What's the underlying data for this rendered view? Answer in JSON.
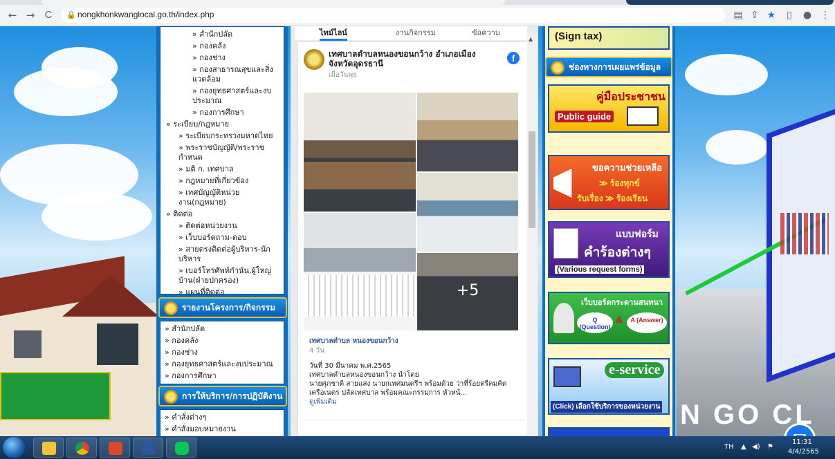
{
  "browser": {
    "url": "nongkhonkwanglocal.go.th/index.php",
    "back": "←",
    "forward": "→",
    "reload": "C",
    "lock": "🔒",
    "icons": {
      "translate": "▤",
      "share": "⇪",
      "bookmark": "★",
      "sidepanel": "▯",
      "profile": "●",
      "menu": "⋮"
    }
  },
  "left_menu": {
    "top_items": [
      "» สำนักปลัด",
      "» กองคลัง",
      "» กองช่าง",
      "» กองสาธารณสุขและสิ่งแวดล้อม",
      "» กองยุทธศาสตร์และงบประมาณ",
      "» กองการศึกษา"
    ],
    "reg_title": "» ระเบียบ/กฎหมาย",
    "reg_items": [
      "» ระเบียบกระทรวงมหาดไทย",
      "» พระราชบัญญัติ/พระราชกำหนด",
      "» มติ ก. เทศบาล",
      "» กฎหมายที่เกี่ยวข้อง",
      "» เทศบัญญัติหน่วยงาน(กฎหมาย)"
    ],
    "contact_title": "» ติดต่อ",
    "contact_items": [
      "» ติดต่อหน่วยงาน",
      "» เว็บบอร์ดถาม-ตอบ",
      "» สายตรงติดต่อผู้บริหาร-นักบริหาร",
      "» เบอร์โทรศัพท์กำนัน,ผู้ใหญ่บ้าน(ฝ่ายปกครอง)",
      "» แผนที่ติดต่อ"
    ],
    "report_head": "รายงานโครงการ/กิจกรรม",
    "report_items": [
      "» สำนักปลัด",
      "» กองคลัง",
      "» กองช่าง",
      "» กองยุทธศาสตร์และงบประมาณ",
      "» กองการศึกษา"
    ],
    "service_head": "การให้บริการ/การปฏิบัติงาน",
    "service_items": [
      "» คำสั่งต่างๆ",
      "» คำสั่งมอบหมายงาน"
    ]
  },
  "facebook": {
    "tabs": [
      "ไทม์ไลน์",
      "งานกิจกรรม",
      "ข้อความ"
    ],
    "page_name": "เทศบาลตำบลหนองขอนกว้าง อำเภอเมือง จังหวัดอุดรธานี",
    "post_time": "เมื่อวันพุธ",
    "more_photos": "+5",
    "author": "เทศบาลตำบล หนองขอนกว้าง",
    "author_time": "4 วัน",
    "date_line": "วันที่ 30 มีนาคม พ.ศ.2565",
    "body_lines": [
      "เทศบาลตำบลหนองขอนกว้าง นำโดย",
      "นายศุภชาติ สายแสง นายกเทศมนตรีฯ พร้อมด้วย ว่าที่ร้อยตรีคมคิด",
      "เครือเนตร ปลัดเทศบาล พร้อมคณะกรรมการ หัวหน้..."
    ],
    "see_more": "ดูเพิ่มเติม"
  },
  "right_col": {
    "sign_tax": "(Sign tax)",
    "channel_head": "ช่องทางการเผยแพร่ข้อมูล",
    "b1_title": "คู่มือประชาชน",
    "b1_sub": "Public guide",
    "b2_title": "ขอความช่วยเหลือ",
    "b2_l1": "≫ ร้องทุกข์",
    "b2_l2": "รับเรื่อง ≫ ร้องเรียน",
    "b3_title": "แบบฟอร์ม",
    "b3_mid": "คำร้องต่างๆ",
    "b3_sub": "(Various request forms)",
    "b4_title": "เว็บบอร์ดกระดานสนทนา",
    "b4_q": "Q (Question)",
    "b4_amp": "&",
    "b4_a": "A (Answer)",
    "b5_title": "e-service",
    "b5_sub": "(Click) เลือกใช้บริการของหน่วยงาน"
  },
  "background": {
    "bottom_letters": "N GO CL"
  },
  "taskbar": {
    "lang": "TH",
    "time": "11:31",
    "date": "4/4/2565"
  }
}
